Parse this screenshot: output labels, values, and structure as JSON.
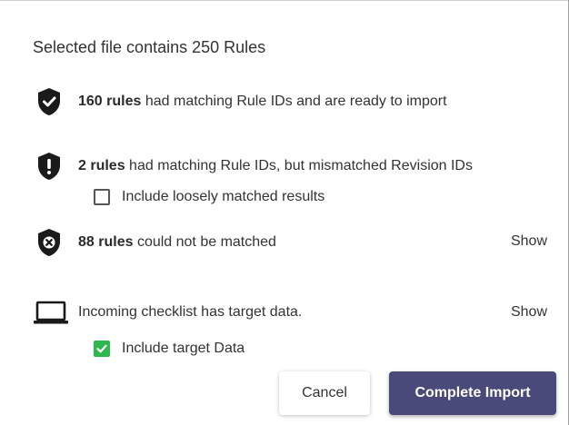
{
  "dialog": {
    "title": "Selected file contains 250 Rules"
  },
  "rows": [
    {
      "icon": "shield-check-icon",
      "count": "160 rules",
      "text": "had matching Rule IDs and are ready to import"
    },
    {
      "icon": "shield-exclamation-icon",
      "count": "2 rules",
      "text": "had matching Rule IDs, but mismatched Revision IDs"
    },
    {
      "icon": "shield-x-icon",
      "count": "88 rules",
      "text": "could not be matched",
      "action": "Show"
    },
    {
      "icon": "laptop-icon",
      "text": "Incoming checklist has target data.",
      "action": "Show"
    }
  ],
  "checkboxes": {
    "loose": {
      "label": "Include loosely matched results",
      "checked": false
    },
    "target": {
      "label": "Include target Data",
      "checked": true
    }
  },
  "buttons": {
    "cancel": "Cancel",
    "complete": "Complete Import"
  },
  "colors": {
    "primary": "#4a4a7a",
    "checked": "#2db84d",
    "icon": "#1a1a1a"
  }
}
